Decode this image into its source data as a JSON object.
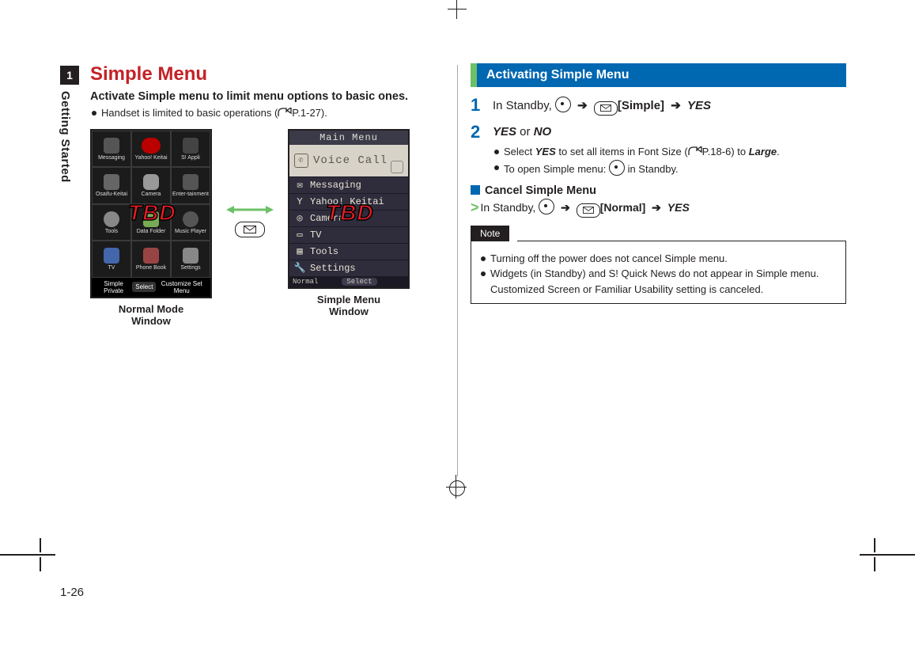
{
  "chapter_tab": "1",
  "side_label": "Getting Started",
  "page_number": "1-26",
  "left": {
    "heading": "Simple Menu",
    "lead": "Activate Simple menu to limit menu options to basic ones.",
    "bullets": [
      {
        "pre": "Handset is limited to basic operations (",
        "ref": "P.1-27",
        "post": ")."
      }
    ],
    "normal_grid": [
      [
        "Messaging",
        "Yahoo! Keitai",
        "S! Appli"
      ],
      [
        "Osaifu-Keitai",
        "Camera",
        "Enter-tainment"
      ],
      [
        "Tools",
        "Data Folder",
        "Music Player"
      ],
      [
        "TV",
        "Phone Book",
        "Settings"
      ]
    ],
    "normal_softkeys": {
      "left": "Simple Private",
      "center": "Select",
      "right": "Customize Set Menu"
    },
    "normal_caption_l1": "Normal Mode",
    "normal_caption_l2": "Window",
    "tbd": "TBD",
    "simple_menu": {
      "title": "Main Menu",
      "voice": "Voice Call",
      "items": [
        {
          "icon": "mail",
          "text": "Messaging"
        },
        {
          "icon": "y",
          "text": "Yahoo! Keitai"
        },
        {
          "icon": "camera",
          "text": "Camera"
        },
        {
          "icon": "tv",
          "text": "TV"
        },
        {
          "icon": "tools",
          "text": "Tools"
        },
        {
          "icon": "settings",
          "text": "Settings"
        }
      ],
      "soft_left": "Normal",
      "soft_center": "Select"
    },
    "simple_caption_l1": "Simple Menu",
    "simple_caption_l2": "Window"
  },
  "right": {
    "section_title": "Activating Simple Menu",
    "steps": [
      {
        "num": "1",
        "prefix": "In Standby, ",
        "after_dot": " ➔ ",
        "bracket": "[Simple]",
        "after_bracket": " ➔ ",
        "yes": "YES"
      },
      {
        "num": "2",
        "yes": "YES",
        "or": " or ",
        "no": "NO",
        "subs": [
          {
            "t1": "Select ",
            "yes": "YES",
            "t2": " to set all items in Font Size (",
            "ref": "P.18-6",
            "t3": ") to ",
            "large": "Large",
            "t4": "."
          },
          {
            "t1": "To open Simple menu: ",
            "t2": " in Standby."
          }
        ]
      }
    ],
    "cancel_head": "Cancel Simple Menu",
    "cancel_line": {
      "prefix": "In Standby, ",
      "after_dot": " ➔ ",
      "bracket": "[Normal]",
      "after_bracket": " ➔ ",
      "yes": "YES"
    },
    "note_label": "Note",
    "notes": [
      "Turning off the power does not cancel Simple menu.",
      "Widgets (in Standby) and S! Quick News do not appear in Simple menu. Customized Screen or Familiar Usability setting is canceled."
    ]
  }
}
